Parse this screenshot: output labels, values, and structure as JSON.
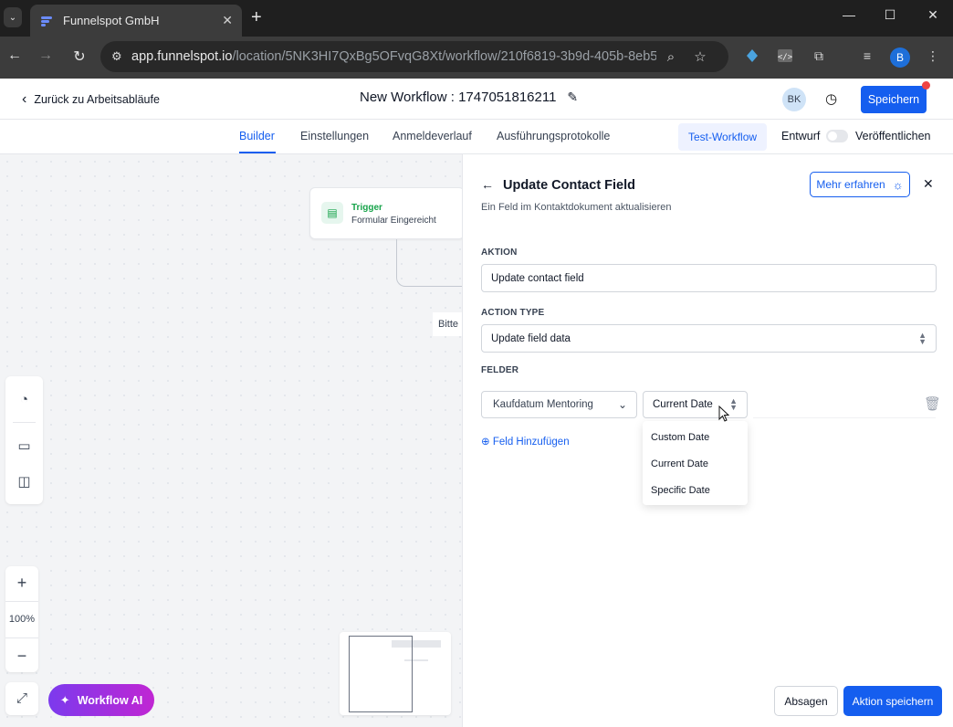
{
  "browser": {
    "tab_title": "Funnelspot GmbH",
    "url_host": "app.funnelspot.io",
    "url_path": "/location/5NK3HI7QxBg5OFvqG8Xt/workflow/210f6819-3b9d-405b-8eb5...",
    "profile_initial": "B"
  },
  "header": {
    "back_label": "Zurück zu Arbeitsabläufe",
    "workflow_title": "New Workflow : 1747051816211",
    "avatar_initials": "BK",
    "save_label": "Speichern"
  },
  "tabs": [
    {
      "label": "Builder",
      "active": true
    },
    {
      "label": "Einstellungen",
      "active": false
    },
    {
      "label": "Anmeldeverlauf",
      "active": false
    },
    {
      "label": "Ausführungsprotokolle",
      "active": false
    }
  ],
  "test_workflow_label": "Test-Workflow",
  "draft_label": "Entwurf",
  "publish_label": "Veröffentlichen",
  "canvas": {
    "trigger_title": "Trigger",
    "trigger_subtitle": "Formular Eingereicht",
    "truncated_node_text": "Bitte",
    "zoom_level": "100%",
    "zoom_in": "+",
    "zoom_out": "−",
    "ai_button_label": "Workflow AI"
  },
  "drawer": {
    "title": "Update Contact Field",
    "subtitle": "Ein Feld im Kontaktdokument aktualisieren",
    "learn_more_label": "Mehr erfahren",
    "action_label": "AKTION",
    "action_value": "Update contact field",
    "action_type_label": "ACTION TYPE",
    "action_type_value": "Update field data",
    "fields_label": "FELDER",
    "field_name_value": "Kaufdatum Mentoring",
    "field_value_selected": "Current Date",
    "field_value_options": [
      "Custom Date",
      "Current Date",
      "Specific Date"
    ],
    "add_field_label": "Feld Hinzufügen",
    "cancel_label": "Absagen",
    "save_action_label": "Aktion speichern"
  },
  "colors": {
    "primary": "#155eef",
    "trigger_green": "#16a34a",
    "ai_gradient_start": "#7c3aed",
    "ai_gradient_end": "#c026d3"
  }
}
